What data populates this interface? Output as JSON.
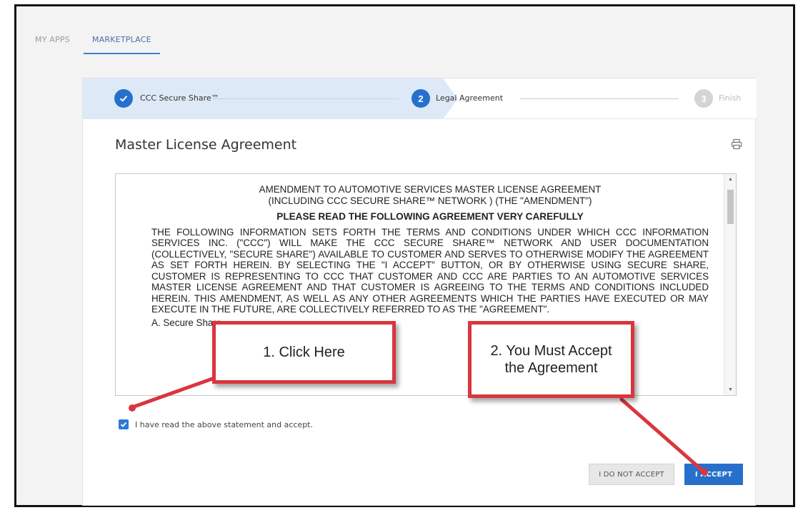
{
  "nav": {
    "tabs": [
      {
        "label": "MY APPS",
        "active": false
      },
      {
        "label": "MARKETPLACE",
        "active": true
      }
    ]
  },
  "stepper": {
    "steps": [
      {
        "number": "",
        "label": "CCC Secure Share™",
        "state": "done"
      },
      {
        "number": "2",
        "label": "Legal Agreement",
        "state": "current"
      },
      {
        "number": "3",
        "label": "Finish",
        "state": "pending"
      }
    ]
  },
  "card": {
    "title": "Master License Agreement"
  },
  "agreement": {
    "heading_line1": "AMENDMENT TO AUTOMOTIVE SERVICES MASTER LICENSE AGREEMENT",
    "heading_line2": "(INCLUDING CCC SECURE SHARE™ NETWORK ) (THE \"AMENDMENT\")",
    "notice": "PLEASE READ THE FOLLOWING AGREEMENT VERY CAREFULLY",
    "body": "THE FOLLOWING INFORMATION SETS FORTH THE TERMS AND CONDITIONS UNDER WHICH CCC INFORMATION SERVICES INC. (\"CCC\") WILL MAKE THE CCC SECURE SHARE™ NETWORK AND USER DOCUMENTATION (COLLECTIVELY, \"SECURE SHARE\") AVAILABLE TO CUSTOMER AND SERVES TO OTHERWISE MODIFY THE AGREEMENT AS SET FORTH HEREIN. BY SELECTING THE \"I ACCEPT\" BUTTON, OR BY OTHERWISE USING SECURE SHARE, CUSTOMER IS REPRESENTING TO CCC THAT CUSTOMER AND CCC ARE PARTIES TO AN AUTOMOTIVE SERVICES MASTER LICENSE AGREEMENT AND THAT CUSTOMER IS AGREEING TO THE TERMS AND CONDITIONS INCLUDED HEREIN. THIS AMENDMENT, AS WELL AS ANY OTHER AGREEMENTS WHICH THE PARTIES HAVE EXECUTED OR MAY EXECUTE IN THE FUTURE, ARE COLLECTIVELY REFERRED TO AS THE \"AGREEMENT\".",
    "section": "A.   Secure Share"
  },
  "consent": {
    "checked": true,
    "label": "I have read the above statement and accept."
  },
  "buttons": {
    "decline": "I DO NOT ACCEPT",
    "accept": "I ACCEPT"
  },
  "annotations": {
    "callout1": "1. Click Here",
    "callout2_line1": "2. You Must Accept",
    "callout2_line2": "the Agreement"
  },
  "colors": {
    "accent": "#2670cc",
    "step_bg": "#dde9f6",
    "callout_border": "#d9363e"
  },
  "icons": {
    "print": "print-icon",
    "check": "check-icon"
  }
}
